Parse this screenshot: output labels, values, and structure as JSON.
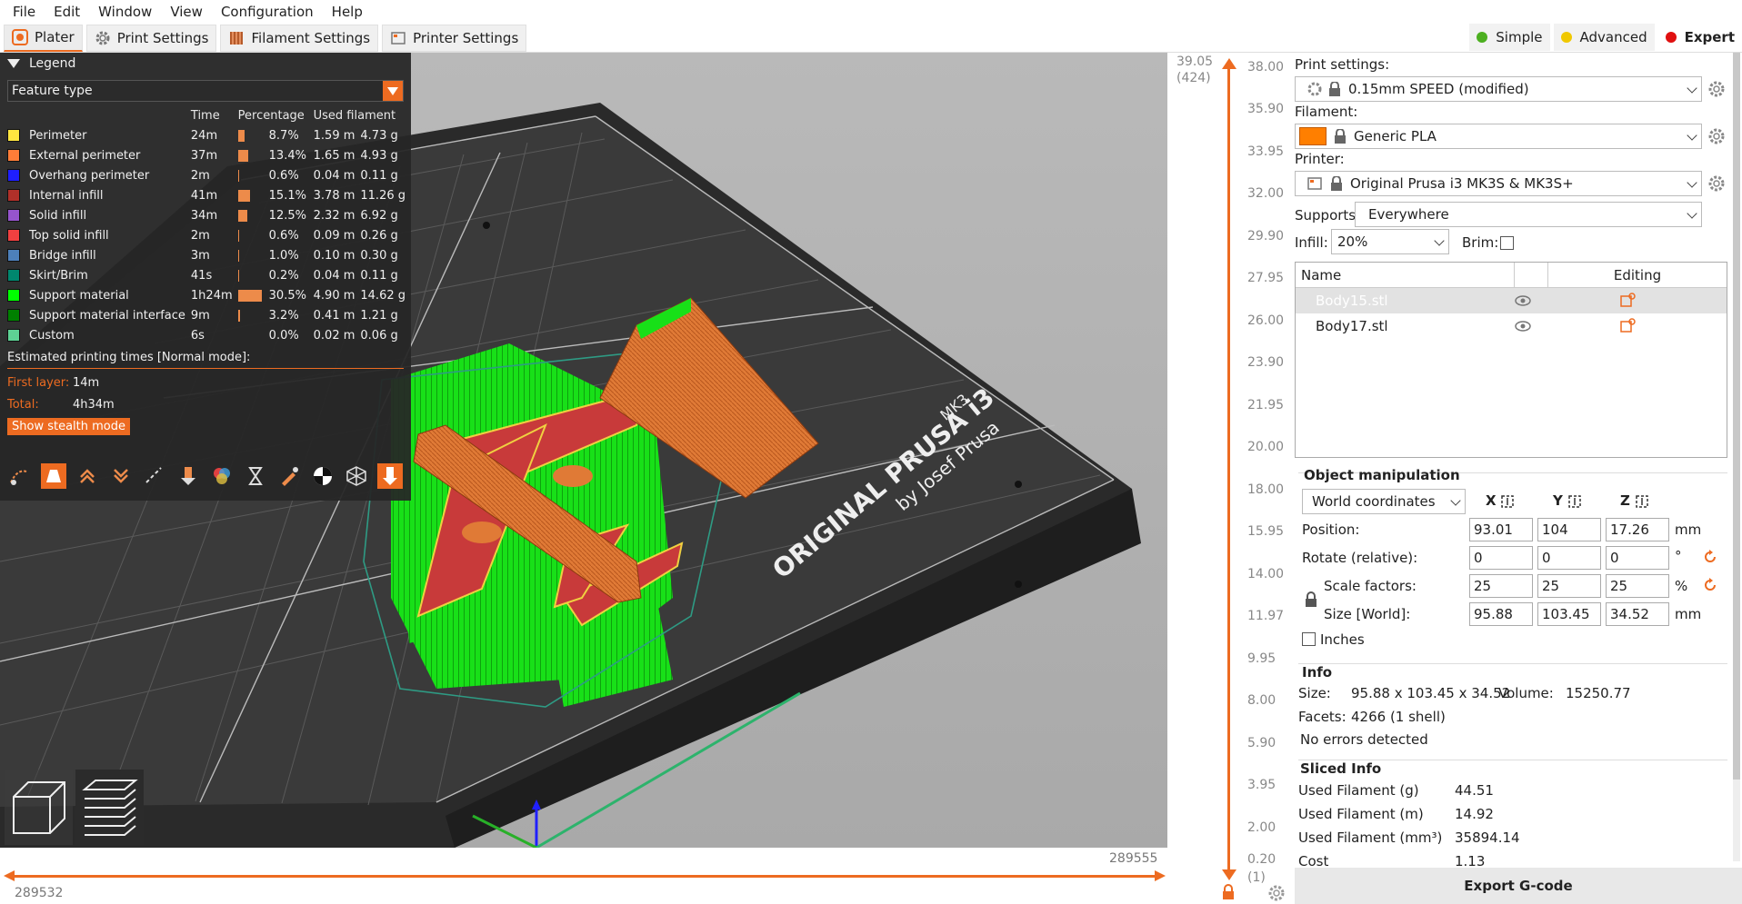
{
  "menu": [
    "File",
    "Edit",
    "Window",
    "View",
    "Configuration",
    "Help"
  ],
  "tabs": [
    {
      "label": "Plater",
      "icon": "plater-icon",
      "active": true
    },
    {
      "label": "Print Settings",
      "icon": "gear-icon",
      "active": false
    },
    {
      "label": "Filament Settings",
      "icon": "filament-spool-icon",
      "active": false
    },
    {
      "label": "Printer Settings",
      "icon": "printer-icon",
      "active": false
    }
  ],
  "modes": [
    {
      "label": "Simple",
      "color": "#4caf20",
      "active": false
    },
    {
      "label": "Advanced",
      "color": "#f0c800",
      "active": false
    },
    {
      "label": "Expert",
      "color": "#e01010",
      "active": true
    }
  ],
  "legend": {
    "title": "Legend",
    "view_type": "Feature type",
    "columns": [
      "Time",
      "Percentage",
      "Used filament"
    ],
    "rows": [
      {
        "name": "Perimeter",
        "color": "#ffe640",
        "time": "24m",
        "pct": "8.7%",
        "pct_value": 8.7,
        "len": "1.59 m",
        "weight": "4.73 g"
      },
      {
        "name": "External perimeter",
        "color": "#ff7d38",
        "time": "37m",
        "pct": "13.4%",
        "pct_value": 13.4,
        "len": "1.65 m",
        "weight": "4.93 g"
      },
      {
        "name": "Overhang perimeter",
        "color": "#1f1fff",
        "time": "2m",
        "pct": "0.6%",
        "pct_value": 0.6,
        "len": "0.04 m",
        "weight": "0.11 g"
      },
      {
        "name": "Internal infill",
        "color": "#b03029",
        "time": "41m",
        "pct": "15.1%",
        "pct_value": 15.1,
        "len": "3.78 m",
        "weight": "11.26 g"
      },
      {
        "name": "Solid infill",
        "color": "#9654cc",
        "time": "34m",
        "pct": "12.5%",
        "pct_value": 12.5,
        "len": "2.32 m",
        "weight": "6.92 g"
      },
      {
        "name": "Top solid infill",
        "color": "#f04040",
        "time": "2m",
        "pct": "0.6%",
        "pct_value": 0.6,
        "len": "0.09 m",
        "weight": "0.26 g"
      },
      {
        "name": "Bridge infill",
        "color": "#4d80ba",
        "time": "3m",
        "pct": "1.0%",
        "pct_value": 1.0,
        "len": "0.10 m",
        "weight": "0.30 g"
      },
      {
        "name": "Skirt/Brim",
        "color": "#00876e",
        "time": "41s",
        "pct": "0.2%",
        "pct_value": 0.2,
        "len": "0.04 m",
        "weight": "0.11 g"
      },
      {
        "name": "Support material",
        "color": "#00ff00",
        "time": "1h24m",
        "pct": "30.5%",
        "pct_value": 30.5,
        "len": "4.90 m",
        "weight": "14.62 g"
      },
      {
        "name": "Support material interface",
        "color": "#008000",
        "time": "9m",
        "pct": "3.2%",
        "pct_value": 3.2,
        "len": "0.41 m",
        "weight": "1.21 g"
      },
      {
        "name": "Custom",
        "color": "#5ed194",
        "time": "6s",
        "pct": "0.0%",
        "pct_value": 0.0,
        "len": "0.02 m",
        "weight": "0.06 g"
      }
    ],
    "estimated_title": "Estimated printing times [Normal mode]:",
    "first_layer_label": "First layer:",
    "first_layer_value": "14m",
    "total_label": "Total:",
    "total_value": "4h34m",
    "stealth_button": "Show stealth mode",
    "toolbar_icons": [
      "travel-icon",
      "wipe-icon",
      "retractions-icon",
      "deretractions-icon",
      "seams-icon",
      "tool-changes-icon",
      "color-changes-icon",
      "pause-icon",
      "custom-gcode-icon",
      "center-of-gravity-icon",
      "shells-icon",
      "tool-marker-icon"
    ]
  },
  "bed": {
    "brand_line1": "ORIGINAL PRUSA i3",
    "brand_mk3": "MK3",
    "brand_line2": "by Josef Prusa"
  },
  "hslider": {
    "left": "289532",
    "right": "289555"
  },
  "vslider": {
    "top_value": "39.05",
    "top_layer": "(424)",
    "bottom_value": "0.20",
    "bottom_layer": "(1)",
    "ticks": [
      "38.00",
      "35.90",
      "33.95",
      "32.00",
      "29.90",
      "27.95",
      "26.00",
      "23.90",
      "21.95",
      "20.00",
      "18.00",
      "15.95",
      "14.00",
      "11.97",
      "9.95",
      "8.00",
      "5.90",
      "3.95",
      "2.00"
    ]
  },
  "sidebar": {
    "print_settings_label": "Print settings:",
    "print_settings_value": "0.15mm SPEED (modified)",
    "filament_label": "Filament:",
    "filament_value": "Generic PLA",
    "filament_color": "#ff7f00",
    "printer_label": "Printer:",
    "printer_value": "Original Prusa i3 MK3S & MK3S+",
    "supports_label": "Supports:",
    "supports_value": "Everywhere",
    "infill_label": "Infill:",
    "infill_value": "20%",
    "brim_label": "Brim:",
    "list_name_header": "Name",
    "list_editing_header": "Editing",
    "objects": [
      {
        "name": "Body15.stl",
        "selected": true
      },
      {
        "name": "Body17.stl",
        "selected": false
      }
    ],
    "object_manipulation_title": "Object manipulation",
    "coord_system": "World coordinates",
    "axes": [
      "X",
      "Y",
      "Z"
    ],
    "position_label": "Position:",
    "position": [
      "93.01",
      "104",
      "17.26"
    ],
    "position_unit": "mm",
    "rotate_label": "Rotate (relative):",
    "rotate": [
      "0",
      "0",
      "0"
    ],
    "rotate_unit": "°",
    "scale_label": "Scale factors:",
    "scale": [
      "25",
      "25",
      "25"
    ],
    "scale_unit": "%",
    "size_label": "Size [World]:",
    "size": [
      "95.88",
      "103.45",
      "34.52"
    ],
    "size_unit": "mm",
    "inches_label": "Inches",
    "info_title": "Info",
    "info_size_label": "Size:",
    "info_size_value": "95.88 x 103.45 x 34.52",
    "info_volume_label": "Volume:",
    "info_volume_value": "15250.77",
    "info_facets_label": "Facets:",
    "info_facets_value": "4266 (1 shell)",
    "info_errors": "No errors detected",
    "sliced_title": "Sliced Info",
    "sliced": [
      {
        "label": "Used Filament (g)",
        "value": "44.51"
      },
      {
        "label": "Used Filament (m)",
        "value": "14.92"
      },
      {
        "label": "Used Filament (mm³)",
        "value": "35894.14"
      },
      {
        "label": "Cost",
        "value": "1.13"
      }
    ],
    "export_button": "Export G-code"
  }
}
